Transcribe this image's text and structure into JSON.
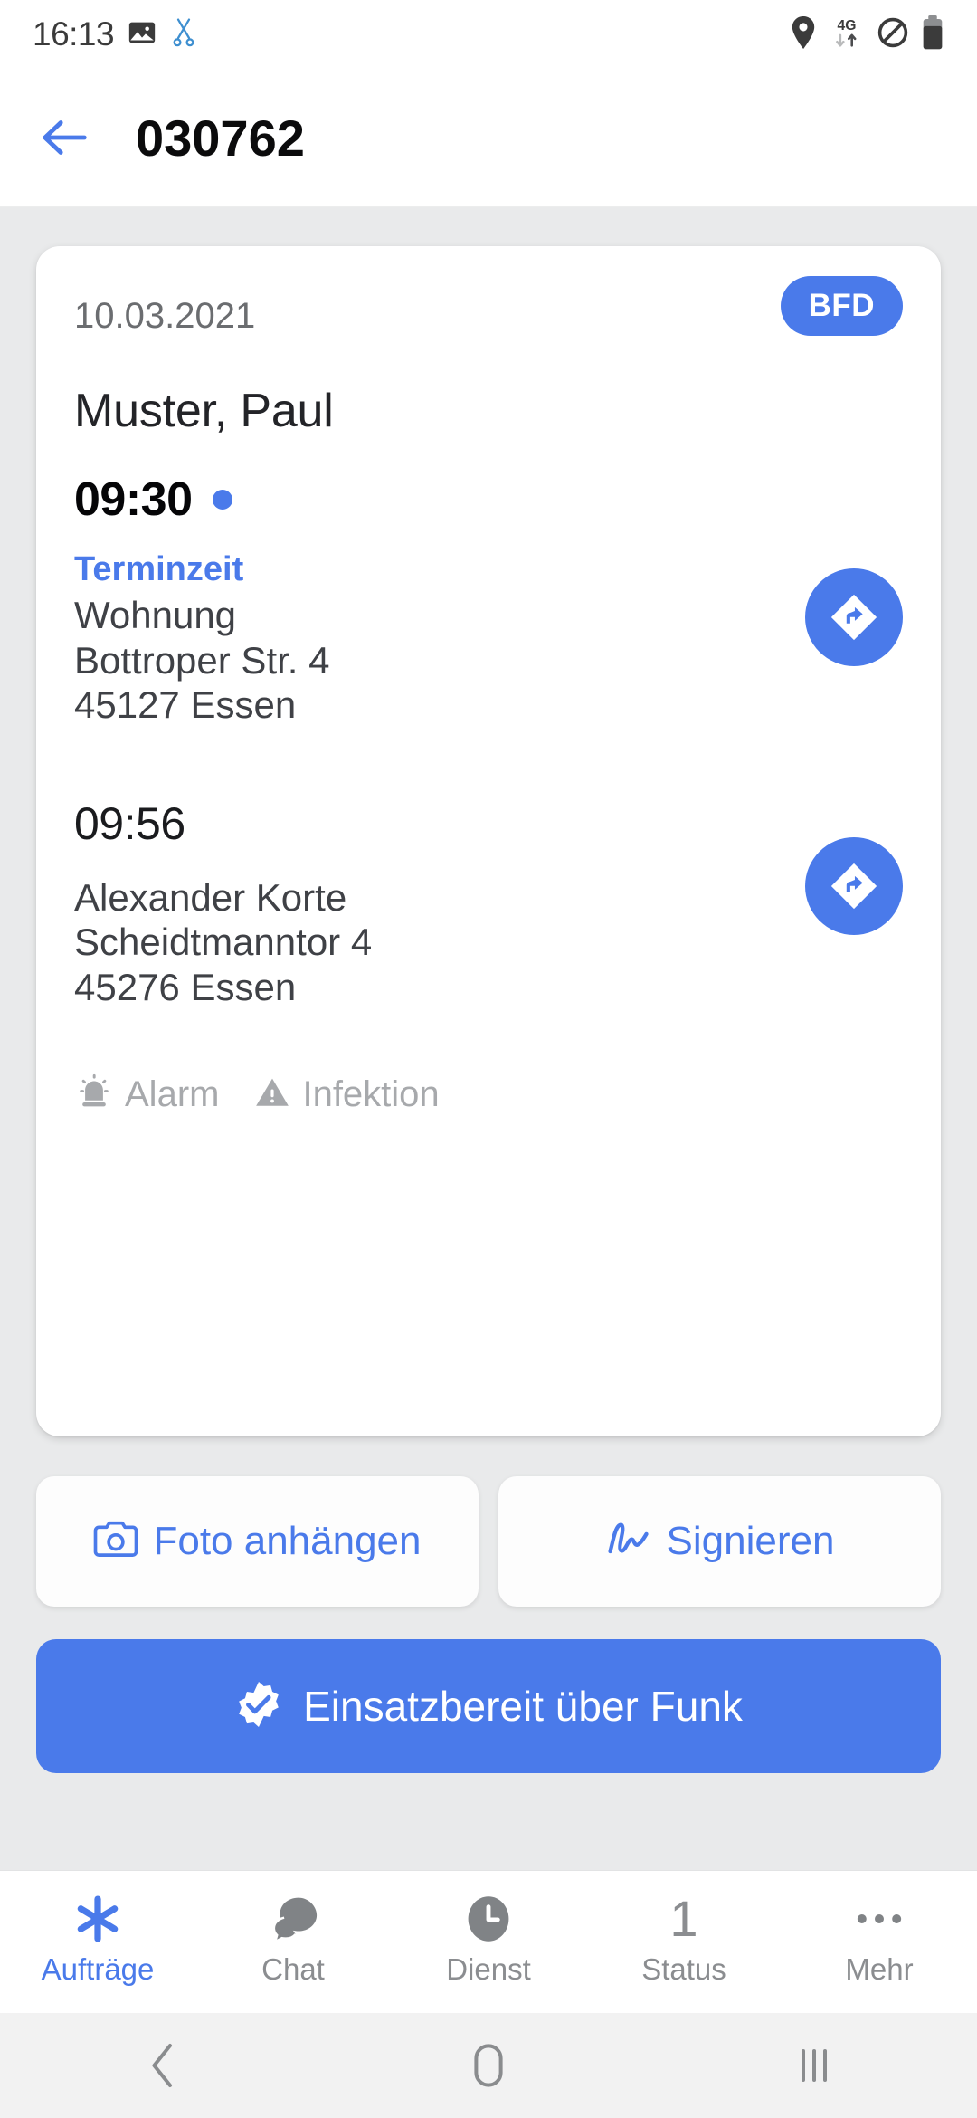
{
  "status_bar": {
    "time": "16:13",
    "left_icons": [
      "image-icon",
      "scissors-icon"
    ],
    "right_icons": [
      "location-pin-icon",
      "4g-signal-icon",
      "do-not-disturb-icon",
      "battery-icon"
    ],
    "network_label": "4G"
  },
  "app_bar": {
    "back_icon": "back-arrow-icon",
    "title": "030762"
  },
  "job_card": {
    "date": "10.03.2021",
    "badge": "BFD",
    "patient_name": "Muster, Paul",
    "pickup": {
      "time": "09:30",
      "has_dot": true,
      "label": "Terminzeit",
      "place": "Wohnung",
      "street": "Bottroper Str. 4",
      "city": "45127 Essen",
      "nav_icon": "navigation-arrow-icon"
    },
    "destination": {
      "time": "09:56",
      "name": "Alexander Korte",
      "street": "Scheidtmanntor 4",
      "city": "45276 Essen",
      "nav_icon": "navigation-arrow-icon"
    },
    "flags": [
      {
        "icon": "siren-alarm-icon",
        "label": "Alarm"
      },
      {
        "icon": "warning-triangle-icon",
        "label": "Infektion"
      }
    ]
  },
  "actions": {
    "photo": {
      "icon": "camera-icon",
      "label": "Foto anhängen"
    },
    "sign": {
      "icon": "signature-icon",
      "label": "Signieren"
    },
    "primary": {
      "icon": "verified-check-icon",
      "label": "Einsatzbereit über Funk"
    }
  },
  "bottom_nav": [
    {
      "icon": "asterisk-icon",
      "label": "Aufträge",
      "active": true
    },
    {
      "icon": "chat-bubbles-icon",
      "label": "Chat",
      "active": false
    },
    {
      "icon": "clock-icon",
      "label": "Dienst",
      "active": false
    },
    {
      "icon": "number-one",
      "label": "Status",
      "active": false,
      "value": "1"
    },
    {
      "icon": "more-dots-icon",
      "label": "Mehr",
      "active": false
    }
  ],
  "system_nav": {
    "back": "system-back-icon",
    "home": "system-home-icon",
    "recents": "system-recents-icon"
  },
  "colors": {
    "accent": "#4a7aea",
    "page_bg": "#e9eaeb",
    "card_bg": "#ffffff",
    "muted_text": "#a7a9ac"
  }
}
